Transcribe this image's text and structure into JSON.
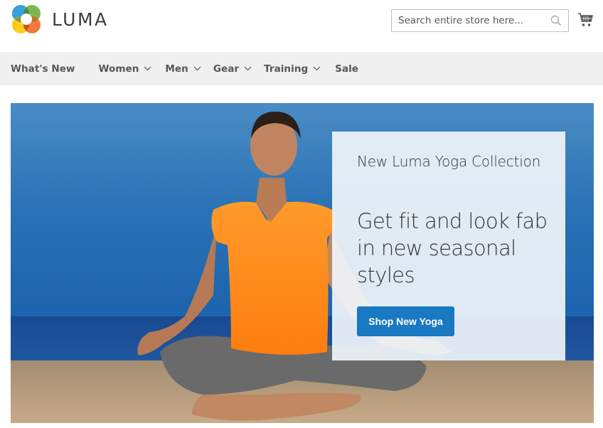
{
  "header": {
    "logo_text": "LUMA",
    "logo_icon": "luma-logo-icon",
    "search": {
      "placeholder": "Search entire store here...",
      "value": "",
      "icon": "search-icon"
    },
    "cart_icon": "cart-icon"
  },
  "nav": {
    "items": [
      {
        "label": "What's New",
        "has_dropdown": false
      },
      {
        "label": "Women",
        "has_dropdown": true
      },
      {
        "label": "Men",
        "has_dropdown": true
      },
      {
        "label": "Gear",
        "has_dropdown": true
      },
      {
        "label": "Training",
        "has_dropdown": true
      },
      {
        "label": "Sale",
        "has_dropdown": false
      }
    ]
  },
  "hero": {
    "image_description": "Woman in orange top meditating cross-legged on a beach",
    "subtitle": "New Luma Yoga Collection",
    "title": "Get fit and look fab in new seasonal styles",
    "button_label": "Shop New Yoga",
    "colors": {
      "button": "#1979c3",
      "sky": "#2a6fb0",
      "sea": "#1a4f96",
      "sand": "#b79d7d",
      "shirt": "#ff8a1c"
    }
  }
}
